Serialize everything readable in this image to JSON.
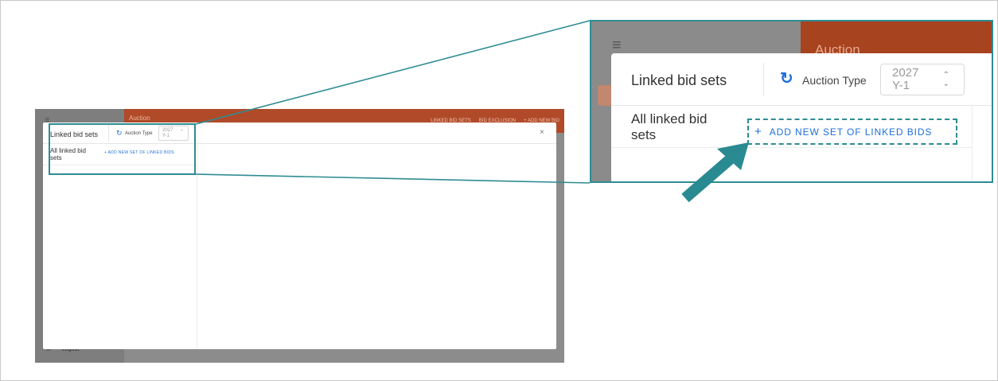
{
  "app": {
    "header_title": "Auction",
    "header_actions": [
      "LINKED BID SETS",
      "BID EXCLUSION",
      "+ ADD NEW BID"
    ],
    "logout_label": "Logout",
    "menu_icon": "hamburger-icon",
    "logout_icon": "logout-icon"
  },
  "modal": {
    "title": "Linked bid sets",
    "refresh_icon": "refresh-icon",
    "auction_type_label": "Auction Type",
    "auction_type_value": "2027\nY-1",
    "select_arrow_icon": "chevron-up-down-icon",
    "close_icon": "close-icon",
    "left_header": "All linked bid\nsets",
    "add_button_label": "ADD NEW SET OF LINKED BIDS",
    "add_icon": "plus-icon"
  },
  "annotation": {
    "highlight_color": "#2e8c93",
    "arrow_color": "#2e8c93",
    "link_color": "#1e6fd9"
  }
}
